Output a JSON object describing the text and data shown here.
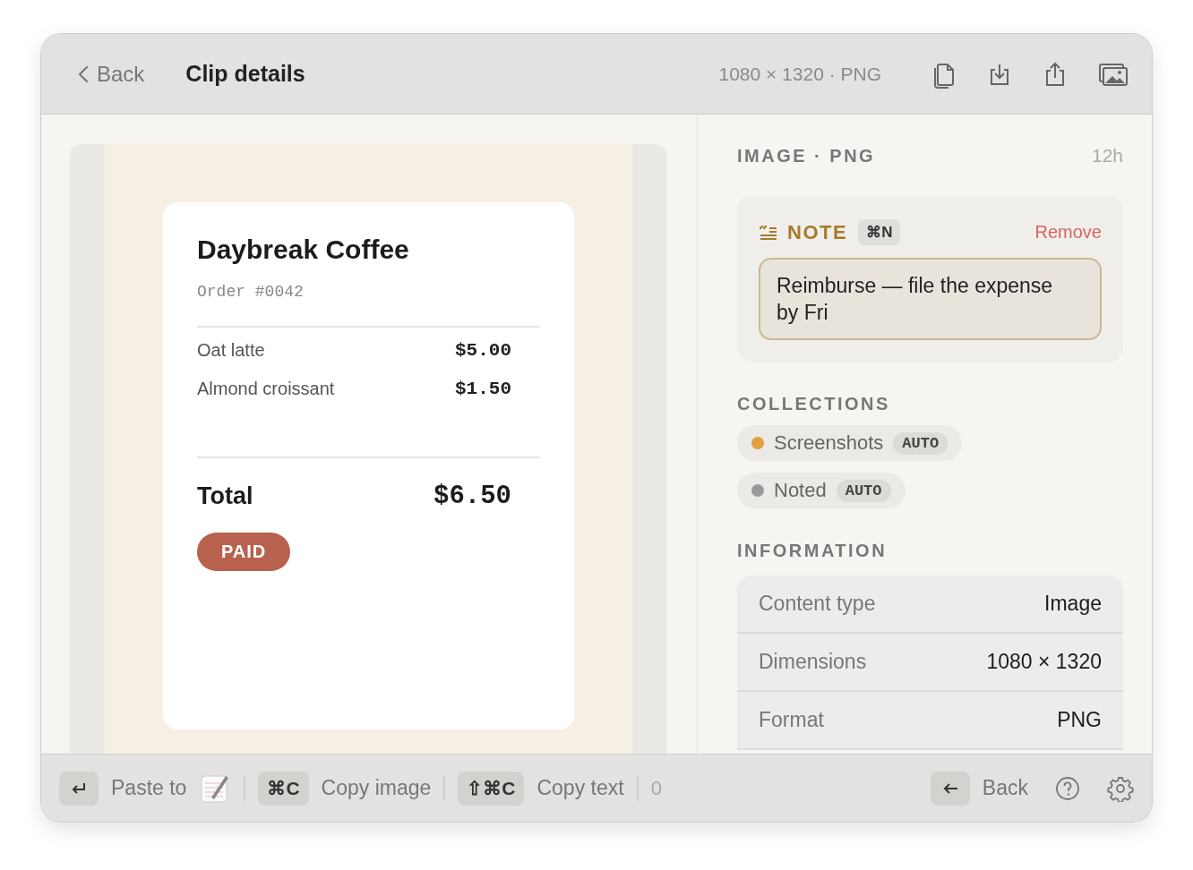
{
  "header": {
    "back": "Back",
    "title": "Clip details",
    "meta": "1080 × 1320 · PNG"
  },
  "preview": {
    "store": "Daybreak Coffee",
    "order": "Order #0042",
    "items": [
      {
        "name": "Oat latte",
        "price": "$5.00"
      },
      {
        "name": "Almond croissant",
        "price": "$1.50"
      }
    ],
    "total_label": "Total",
    "total": "$6.50",
    "status": "PAID"
  },
  "details": {
    "type_label": "IMAGE · PNG",
    "age": "12h",
    "note": {
      "label": "NOTE",
      "shortcut": "⌘N",
      "remove": "Remove",
      "value": "Reimburse — file the expense by Fri"
    },
    "collections_heading": "COLLECTIONS",
    "collections": [
      {
        "name": "Screenshots",
        "tag": "AUTO",
        "color": "#e0a040"
      },
      {
        "name": "Noted",
        "tag": "AUTO",
        "color": "#9a9a9a"
      }
    ],
    "information_heading": "INFORMATION",
    "information": [
      {
        "label": "Content type",
        "value": "Image"
      },
      {
        "label": "Dimensions",
        "value": "1080 × 1320"
      },
      {
        "label": "Format",
        "value": "PNG"
      }
    ]
  },
  "footer": {
    "paste": "Paste to",
    "copy_image_key": "⌘C",
    "copy_image": "Copy image",
    "copy_text_key": "⇧⌘C",
    "copy_text": "Copy text",
    "count": "0",
    "back": "Back"
  }
}
